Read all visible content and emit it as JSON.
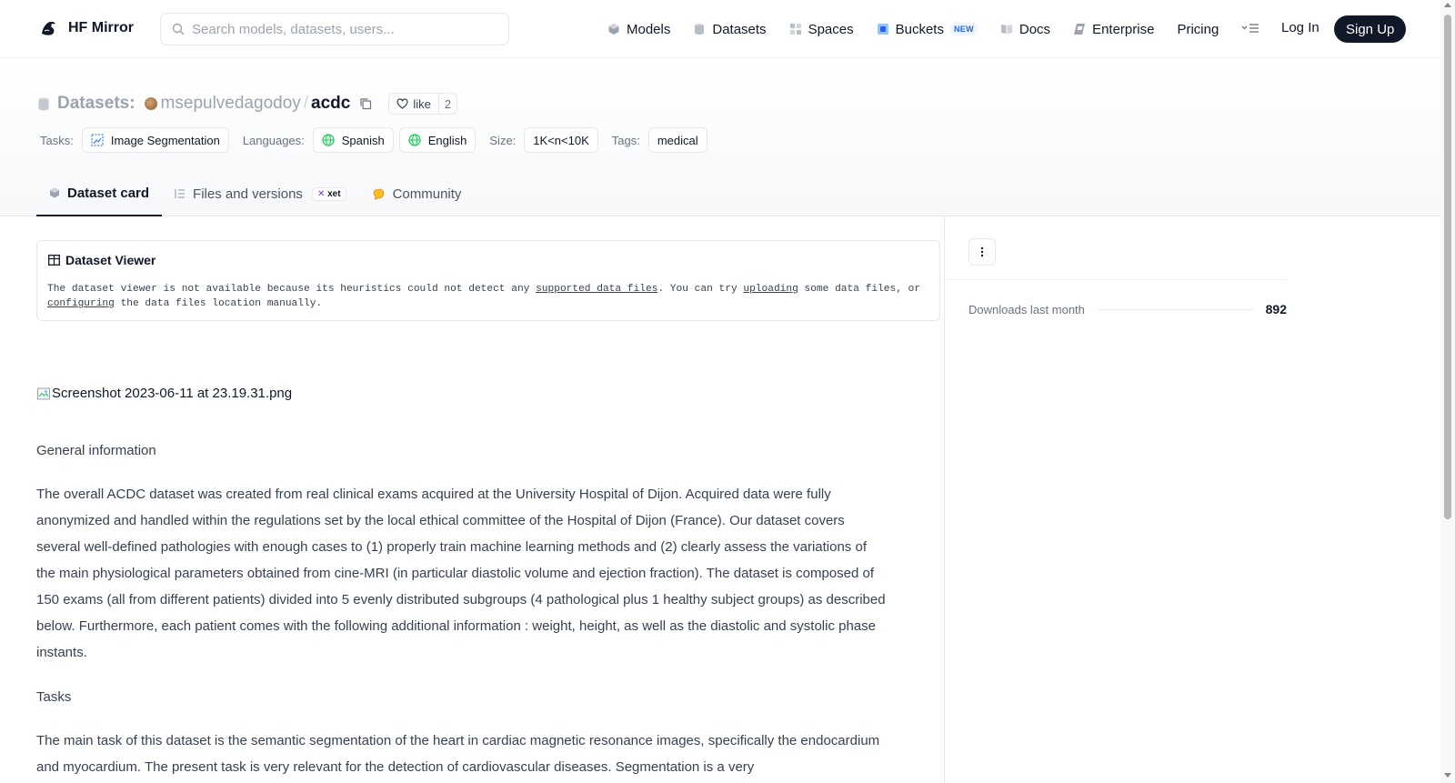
{
  "nav": {
    "brand": "HF Mirror",
    "search_placeholder": "Search models, datasets, users...",
    "links": [
      {
        "label": "Models",
        "icon": "cube-icon"
      },
      {
        "label": "Datasets",
        "icon": "database-icon"
      },
      {
        "label": "Spaces",
        "icon": "grid-icon"
      },
      {
        "label": "Buckets",
        "icon": "bucket-icon",
        "badge": "NEW"
      },
      {
        "label": "Docs",
        "icon": "book-icon"
      },
      {
        "label": "Enterprise",
        "icon": "enterprise-icon"
      },
      {
        "label": "Pricing"
      }
    ],
    "login": "Log In",
    "signup": "Sign Up"
  },
  "header": {
    "type_label": "Datasets:",
    "owner": "msepulvedagodoy",
    "separator": "/",
    "repo": "acdc",
    "like_label": "like",
    "like_count": "2",
    "tags": {
      "tasks_label": "Tasks:",
      "task": "Image Segmentation",
      "languages_label": "Languages:",
      "languages": [
        "Spanish",
        "English"
      ],
      "size_label": "Size:",
      "size": "1K<n<10K",
      "tags_label": "Tags:",
      "tag": "medical"
    },
    "tabs": [
      {
        "label": "Dataset card",
        "active": true
      },
      {
        "label": "Files and versions",
        "badge": "xet"
      },
      {
        "label": "Community"
      }
    ]
  },
  "viewer": {
    "title": "Dataset Viewer",
    "msg_1": "The dataset viewer is not available because its heuristics could not detect any ",
    "link_1": "supported data files",
    "msg_2": ". You can try ",
    "link_2": "uploading",
    "msg_3": " some data files, or ",
    "link_3": "configuring",
    "msg_4": " the data files location manually."
  },
  "card": {
    "image_alt": "Screenshot 2023-06-11 at 23.19.31.png",
    "general_heading": "General information",
    "general_text": "The overall ACDC dataset was created from real clinical exams acquired at the University Hospital of Dijon. Acquired data were fully anonymized and handled within the regulations set by the local ethical committee of the Hospital of Dijon (France). Our dataset covers several well-defined pathologies with enough cases to (1) properly train machine learning methods and (2) clearly assess the variations of the main physiological parameters obtained from cine-MRI (in particular diastolic volume and ejection fraction). The dataset is composed of 150 exams (all from different patients) divided into 5 evenly distributed subgroups (4 pathological plus 1 healthy subject groups) as described below. Furthermore, each patient comes with the following additional information : weight, height, as well as the diastolic and systolic phase instants.",
    "tasks_heading": "Tasks",
    "tasks_text": "The main task of this dataset is the semantic segmentation of the heart in cardiac magnetic resonance images, specifically the endocardium and myocardium. The present task is very relevant for the detection of cardiovascular diseases. Segmentation is a very"
  },
  "sidebar": {
    "downloads_label": "Downloads last month",
    "downloads_value": "892"
  }
}
